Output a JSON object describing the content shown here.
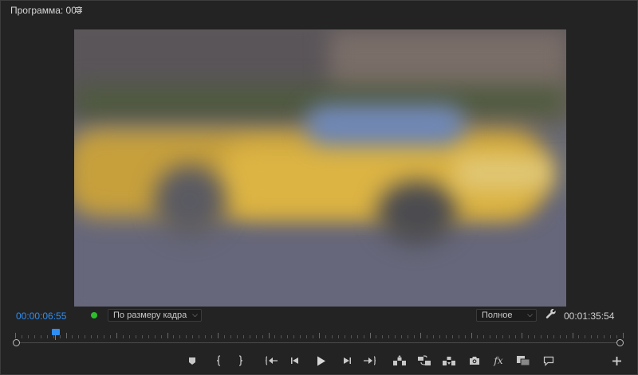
{
  "panel": {
    "title": "Программа: 003",
    "menu_icon": "hamburger-icon"
  },
  "controls": {
    "current_timecode": "00:00:06:55",
    "zoom_select": "По размеру кадра",
    "quality_select": "Полное",
    "total_timecode": "00:01:35:54",
    "settings_icon": "wrench-icon"
  },
  "playhead": {
    "fraction": 0.066
  },
  "buttons": [
    {
      "name": "add-marker-button",
      "icon": "marker-icon"
    },
    {
      "name": "mark-in-button",
      "icon": "mark-in-icon"
    },
    {
      "name": "mark-out-button",
      "icon": "mark-out-icon"
    },
    {
      "name": "go-to-in-button",
      "icon": "go-to-in-icon"
    },
    {
      "name": "step-back-button",
      "icon": "step-back-icon"
    },
    {
      "name": "play-button",
      "icon": "play-icon"
    },
    {
      "name": "step-forward-button",
      "icon": "step-forward-icon"
    },
    {
      "name": "go-to-out-button",
      "icon": "go-to-out-icon"
    },
    {
      "name": "lift-button",
      "icon": "lift-icon"
    },
    {
      "name": "extract-button",
      "icon": "extract-icon"
    },
    {
      "name": "insert-button",
      "icon": "insert-icon"
    },
    {
      "name": "export-frame-button",
      "icon": "camera-icon"
    },
    {
      "name": "fx-button",
      "icon": "fx-icon"
    },
    {
      "name": "comparison-view-button",
      "icon": "comparison-icon"
    },
    {
      "name": "comment-button",
      "icon": "comment-icon"
    },
    {
      "name": "add-button",
      "icon": "plus-icon"
    }
  ],
  "colors": {
    "accent": "#2e8ef3",
    "status_dot": "#2bc02b",
    "background": "#232323"
  }
}
